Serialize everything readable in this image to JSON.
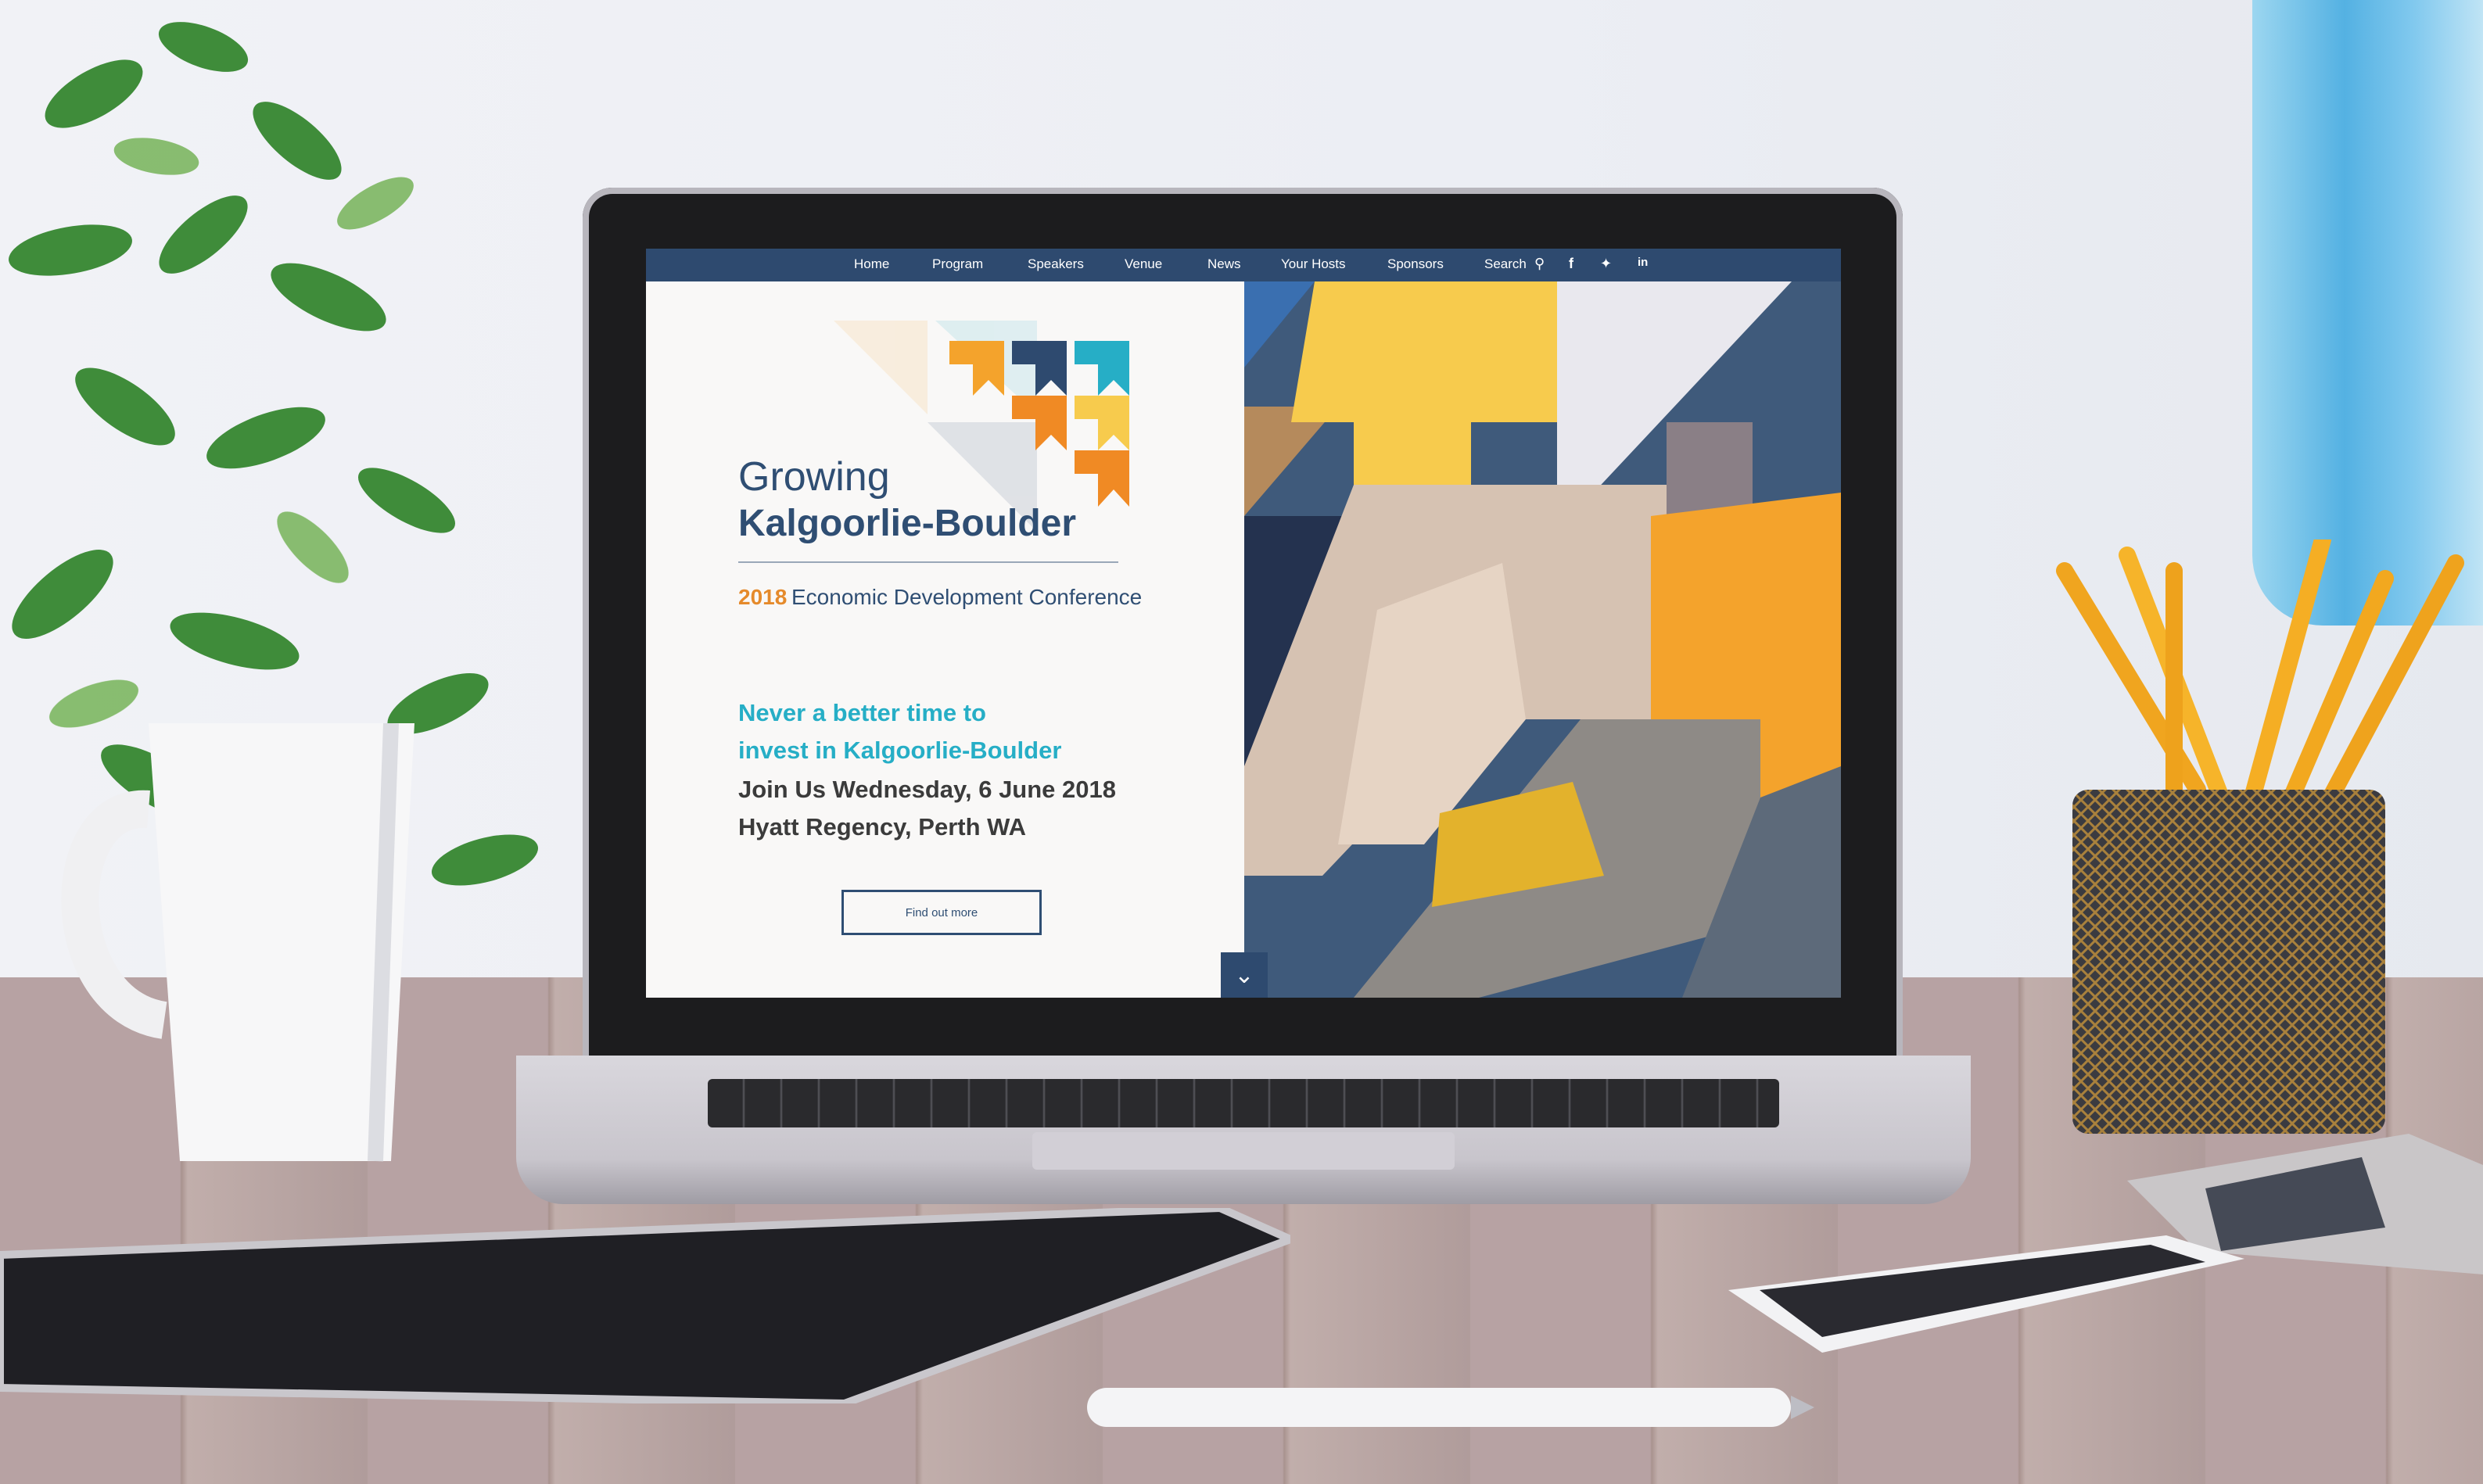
{
  "nav": {
    "items": [
      "Home",
      "Program",
      "Speakers",
      "Venue",
      "News",
      "Your Hosts",
      "Sponsors",
      "Search"
    ],
    "icons": [
      "search-icon",
      "facebook-icon",
      "twitter-icon",
      "linkedin-icon"
    ],
    "color": "#2e4a6f"
  },
  "hero": {
    "title_line1": "Growing",
    "title_line2": "Kalgoorlie-Boulder",
    "year": "2018",
    "conference": "Economic Development Conference",
    "tagline_line1": "Never a better time to",
    "tagline_line2": "invest in Kalgoorlie-Boulder",
    "date_line": "Join Us Wednesday, 6 June 2018",
    "venue_line": "Hyatt Regency, Perth WA",
    "cta_label": "Find out more",
    "scroll_icon": "chevron-down-icon"
  },
  "colors": {
    "navy": "#2e4a6f",
    "orange": "#e58a2b",
    "teal": "#26aec6",
    "yellow": "#f7cb4d",
    "light_orange": "#f4a32c"
  }
}
